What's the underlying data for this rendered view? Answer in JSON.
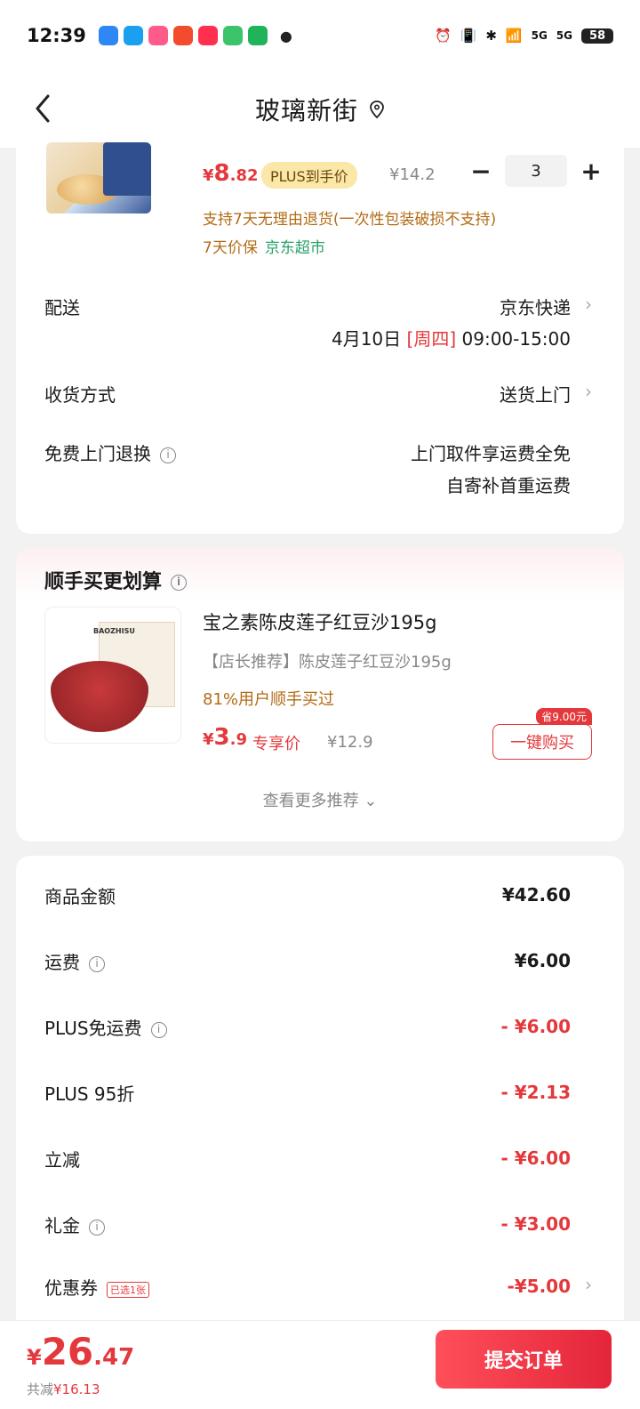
{
  "status_bar": {
    "time": "12:39",
    "signal_label_1": "5G",
    "signal_label_2": "5G",
    "battery": "58"
  },
  "header": {
    "title": "玻璃新街"
  },
  "product": {
    "price_symbol": "¥",
    "price_int": "8",
    "price_dec": ".82",
    "plus_tag": "PLUS到手价",
    "original_price": "¥14.2",
    "quantity": "3",
    "minus_label": "−",
    "plus_label": "+",
    "return_note": "支持7天无理由退货(一次性包装破损不支持)",
    "protect_label": "7天价保",
    "store": "京东超市"
  },
  "delivery": {
    "label": "配送",
    "value": "京东快递",
    "date": "4月10日",
    "weekday": "[周四]",
    "time_slot": "09:00-15:00",
    "receive_label": "收货方式",
    "receive_value": "送货上门",
    "return_label": "免费上门退换",
    "return_value_1": "上门取件享运费全免",
    "return_value_2": "自寄补首重运费"
  },
  "recommend": {
    "title": "顺手买更划算",
    "name": "宝之素陈皮莲子红豆沙195g",
    "desc": "【店长推荐】陈皮莲子红豆沙195g",
    "stat": "81%用户顺手买过",
    "price_symbol": "¥",
    "price_int": "3",
    "price_dec": ".9",
    "exclusive": "专享价",
    "original_price": "¥12.9",
    "save_badge": "省9.00元",
    "buy_button": "一键购买",
    "more": "查看更多推荐",
    "thumb_brand": "BAOZHISU"
  },
  "summary": {
    "rows": [
      {
        "label": "商品金额",
        "value": "¥42.60"
      },
      {
        "label": "运费",
        "value": "¥6.00"
      },
      {
        "label": "PLUS免运费",
        "value": "- ¥6.00"
      },
      {
        "label": "PLUS 95折",
        "value": "- ¥2.13"
      },
      {
        "label": "立减",
        "value": "- ¥6.00"
      },
      {
        "label": "礼金",
        "value": "- ¥3.00"
      },
      {
        "label": "优惠券",
        "value": "-¥5.00"
      }
    ],
    "coupon_tag": "已选1张"
  },
  "bottom": {
    "total_symbol": "¥",
    "total_int": "26",
    "total_dec": ".47",
    "save_label": "共减",
    "save_amount": "¥16.13",
    "submit": "提交订单"
  },
  "colors": {
    "accent_red": "#e4393c",
    "plus_gold": "#fbe7a8",
    "store_green": "#2aa06a",
    "note_brown": "#b26b14"
  }
}
